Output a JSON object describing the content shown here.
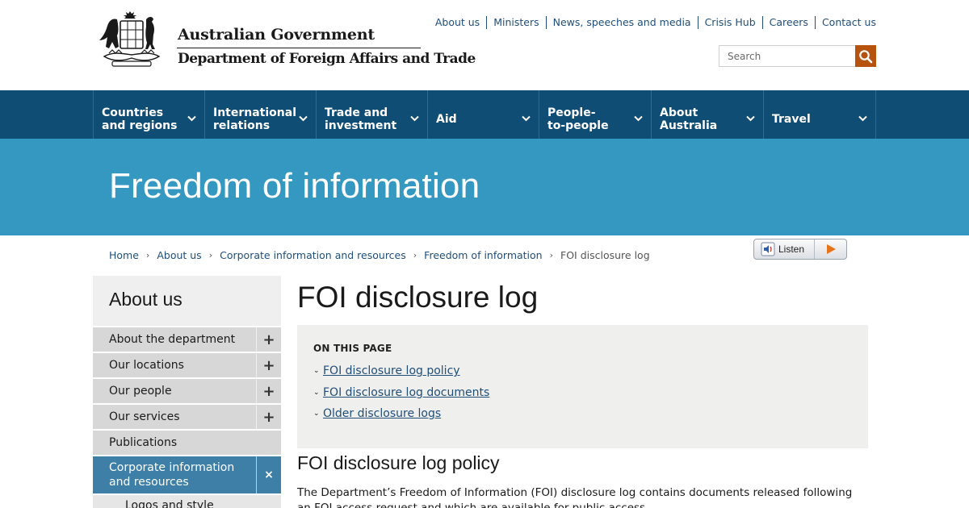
{
  "header": {
    "gov_name": "Australian Government",
    "dept_name": "Department of Foreign Affairs and Trade",
    "utility_links": [
      "About us",
      "Ministers",
      "News, speeches and media",
      "Crisis Hub",
      "Careers",
      "Contact us"
    ],
    "search": {
      "placeholder": "Search",
      "icon": "search-icon",
      "button_color": "#b5530f"
    }
  },
  "main_nav": [
    "Countries and regions",
    "International relations",
    "Trade and investment",
    "Aid",
    "People-to-people",
    "About Australia",
    "Travel"
  ],
  "banner": {
    "title": "Freedom of information",
    "color": "#3598c1"
  },
  "breadcrumb": {
    "links": [
      "Home",
      "About us",
      "Corporate information and resources",
      "Freedom of information"
    ],
    "current": "FOI disclosure log"
  },
  "listen": {
    "label": "Listen"
  },
  "sidebar": {
    "title": "About us",
    "items": [
      {
        "label": "About the department",
        "toggle": "+"
      },
      {
        "label": "Our locations",
        "toggle": "+"
      },
      {
        "label": "Our people",
        "toggle": "+"
      },
      {
        "label": "Our services",
        "toggle": "+"
      },
      {
        "label": "Publications",
        "toggle": ""
      }
    ],
    "active": {
      "label_line1": "Corporate information",
      "label_line2": "and resources",
      "toggle": "×"
    },
    "sub_items": [
      "Logos and style"
    ]
  },
  "content": {
    "title": "FOI disclosure log",
    "on_this_page": {
      "heading": "ON THIS PAGE",
      "links": [
        "FOI disclosure log policy",
        "FOI disclosure log documents",
        "Older disclosure logs"
      ]
    },
    "section_heading": "FOI disclosure log policy",
    "paragraph": "The Department’s Freedom of Information (FOI) disclosure log contains documents released following an FOI access request and which are available for public access."
  },
  "colors": {
    "nav": "#104d75",
    "link": "#1f4e79",
    "sidebar_active": "#3e7fa8"
  }
}
